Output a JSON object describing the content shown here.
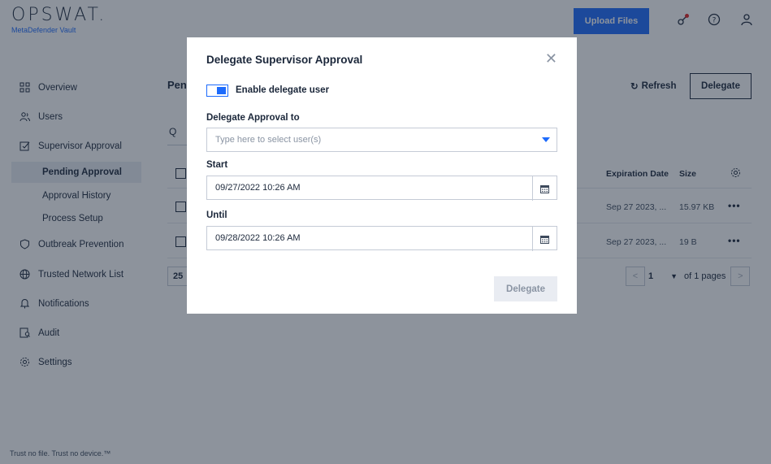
{
  "header": {
    "logo": "OPSWAT.",
    "product": "MetaDefender Vault",
    "upload_label": "Upload Files"
  },
  "sidebar": {
    "items": [
      {
        "label": "Overview",
        "icon": "grid-icon"
      },
      {
        "label": "Users",
        "icon": "users-icon"
      },
      {
        "label": "Supervisor Approval",
        "icon": "approval-icon"
      },
      {
        "label": "Outbreak Prevention",
        "icon": "shield-icon"
      },
      {
        "label": "Trusted Network List",
        "icon": "globe-icon"
      },
      {
        "label": "Notifications",
        "icon": "bell-icon"
      },
      {
        "label": "Audit",
        "icon": "audit-icon"
      },
      {
        "label": "Settings",
        "icon": "gear-icon"
      }
    ],
    "sub_items": [
      {
        "label": "Pending Approval",
        "active": true
      },
      {
        "label": "Approval History",
        "active": false
      },
      {
        "label": "Process Setup",
        "active": false
      }
    ],
    "footer": "Trust no file. Trust no device.™"
  },
  "main": {
    "title": "Pen",
    "search_prefix": "Q",
    "refresh_label": "Refresh",
    "delegate_label": "Delegate",
    "columns": {
      "expiration": "Expiration Date",
      "size": "Size"
    },
    "rows": [
      {
        "expiration": "Sep 27 2023, ...",
        "size": "15.97 KB"
      },
      {
        "expiration": "Sep 27 2023, ...",
        "size": "19 B"
      }
    ],
    "page_size": "25",
    "current_page": "1",
    "of_pages": "of 1 pages"
  },
  "modal": {
    "title": "Delegate Supervisor Approval",
    "toggle_label": "Enable delegate user",
    "toggle_on": true,
    "delegate_to_label": "Delegate Approval to",
    "delegate_to_placeholder": "Type here to select user(s)",
    "start_label": "Start",
    "start_value": "09/27/2022 10:26 AM",
    "until_label": "Until",
    "until_value": "09/28/2022 10:26 AM",
    "submit_label": "Delegate"
  },
  "colors": {
    "accent": "#1d6bfc",
    "text": "#1b273a",
    "overlay": "rgba(27,39,58,0.5)"
  }
}
